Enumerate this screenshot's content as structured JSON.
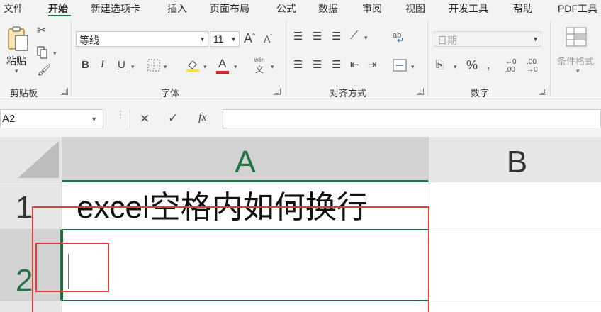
{
  "menu": {
    "tabs": [
      "文件",
      "开始",
      "新建选项卡",
      "插入",
      "页面布局",
      "公式",
      "数据",
      "审阅",
      "视图",
      "开发工具",
      "帮助",
      "PDF工具"
    ],
    "active": "开始"
  },
  "ribbon": {
    "clipboard": {
      "paste_label": "粘贴",
      "group_label": "剪贴板"
    },
    "font": {
      "font_name": "等线",
      "font_size": "11",
      "group_label": "字体",
      "wen_label": "wén",
      "wen_char": "文"
    },
    "alignment": {
      "group_label": "对齐方式",
      "abc_label": "ab"
    },
    "number": {
      "format_value": "日期",
      "group_label": "数字"
    },
    "styles": {
      "conditional_label": "条件格式"
    }
  },
  "formula_bar": {
    "name_box": "A2",
    "fx_label": "fx",
    "formula": ""
  },
  "sheet": {
    "columns": [
      "A",
      "B"
    ],
    "rows": [
      "1",
      "2"
    ],
    "cells": {
      "A1": "excel空格内如何换行",
      "A2": ""
    },
    "active_cell": "A2"
  },
  "colors": {
    "accent_green": "#217346",
    "annotation_red": "#e03c3c"
  }
}
